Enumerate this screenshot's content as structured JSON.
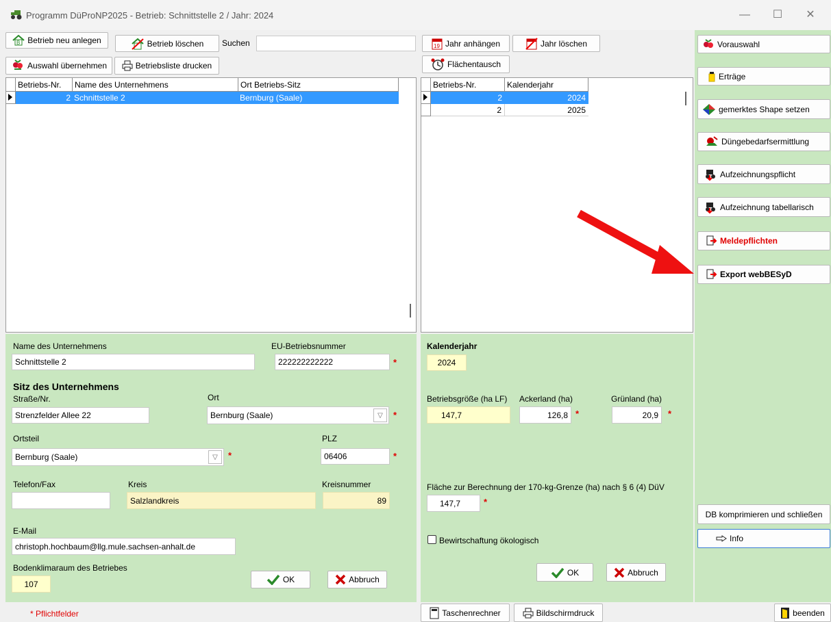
{
  "window": {
    "title": "Programm DüProNP2025 - Betrieb: Schnittstelle 2 / Jahr: 2024"
  },
  "toolbar_left": {
    "new_label": "Betrieb neu anlegen",
    "delete_label": "Betrieb löschen",
    "search_label": "Suchen",
    "search_value": "",
    "apply_label": "Auswahl übernehmen",
    "print_label": "Betriebsliste drucken"
  },
  "toolbar_mid": {
    "add_year_label": "Jahr anhängen",
    "delete_year_label": "Jahr löschen",
    "swap_label": "Flächentausch"
  },
  "betriebe_grid": {
    "headers": [
      "Betriebs-Nr.",
      "Name des Unternehmens",
      "Ort Betriebs-Sitz"
    ],
    "rows": [
      {
        "nr": "2",
        "name": "Schnittstelle 2",
        "ort": "Bernburg (Saale)"
      }
    ]
  },
  "jahre_grid": {
    "headers": [
      "Betriebs-Nr.",
      "Kalenderjahr"
    ],
    "rows": [
      {
        "nr": "2",
        "jahr": "2024"
      },
      {
        "nr": "2",
        "jahr": "2025"
      }
    ]
  },
  "right_panel": {
    "vorauswahl": "Vorauswahl",
    "ertraege": "Erträge",
    "shape": "gemerktes Shape setzen",
    "duenge": "Düngebedarfsermittlung",
    "aufzeichnung": "Aufzeichnungspflicht",
    "aufz_tab": "Aufzeichnung tabellarisch",
    "meldepflichten": "Meldepflichten",
    "export": "Export webBESyD",
    "db": "DB komprimieren und schließen",
    "info": "Info"
  },
  "form_left": {
    "name_label": "Name des Unternehmens",
    "name_value": "Schnittstelle 2",
    "eu_label": "EU-Betriebsnummer",
    "eu_value": "222222222222",
    "sitz_heading": "Sitz des Unternehmens",
    "strasse_label": "Straße/Nr.",
    "strasse_value": "Strenzfelder Allee 22",
    "ort_label": "Ort",
    "ort_value": "Bernburg (Saale)",
    "ortsteil_label": "Ortsteil",
    "ortsteil_value": "Bernburg (Saale)",
    "plz_label": "PLZ",
    "plz_value": "06406",
    "telefon_label": "Telefon/Fax",
    "telefon_value": "",
    "kreis_label": "Kreis",
    "kreis_value": "Salzlandkreis",
    "kreisnr_label": "Kreisnummer",
    "kreisnr_value": "89",
    "email_label": "E-Mail",
    "email_value": "christoph.hochbaum@llg.mule.sachsen-anhalt.de",
    "boden_label": "Bodenklimaraum des Betriebes",
    "boden_value": "107",
    "ok": "OK",
    "abbruch": "Abbruch",
    "star": "*"
  },
  "form_right": {
    "jahr_label": "Kalenderjahr",
    "jahr_value": "2024",
    "groesse_label": "Betriebsgröße (ha LF)",
    "groesse_value": "147,7",
    "acker_label": "Ackerland (ha)",
    "acker_value": "126,8",
    "gruen_label": "Grünland (ha)",
    "gruen_value": "20,9",
    "flaeche_label": "Fläche zur Berechnung der 170-kg-Grenze (ha) nach § 6 (4) DüV",
    "flaeche_value": "147,7",
    "oeko_label": "Bewirtschaftung ökologisch",
    "ok": "OK",
    "abbruch": "Abbruch"
  },
  "statusbar": {
    "pflicht": "* Pflichtfelder",
    "rechner": "Taschenrechner",
    "druck": "Bildschirmdruck",
    "beenden": "beenden"
  },
  "colors": {
    "panel_green": "#c9e7c0",
    "selection": "#3399ff",
    "required": "#e00000",
    "highlight_field": "#ffffcc"
  }
}
